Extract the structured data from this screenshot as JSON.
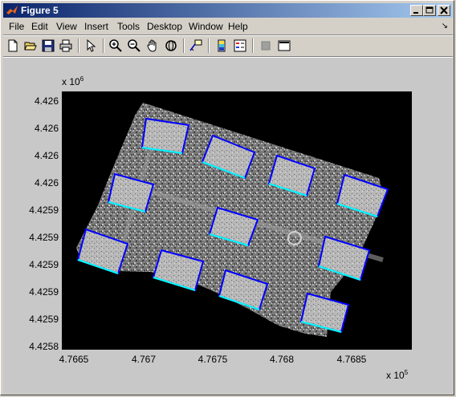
{
  "window": {
    "title": "Figure 5",
    "minimize_icon": "minimize-icon",
    "maximize_icon": "maximize-icon",
    "close_icon": "close-icon"
  },
  "menu": {
    "items": [
      "File",
      "Edit",
      "View",
      "Insert",
      "Tools",
      "Desktop",
      "Window",
      "Help"
    ],
    "dock_arrow": "↘"
  },
  "toolbar": {
    "icons": [
      "new-figure-icon",
      "open-file-icon",
      "save-icon",
      "print-icon",
      "edit-plot-arrow-icon",
      "zoom-in-icon",
      "zoom-out-icon",
      "pan-hand-icon",
      "rotate-3d-icon",
      "data-cursor-icon",
      "colorbar-icon",
      "legend-icon",
      "hide-plot-tools-icon",
      "show-plot-tools-icon"
    ]
  },
  "axes": {
    "y_exponent_base": "x 10",
    "y_exponent_power": "6",
    "x_exponent_base": "x 10",
    "x_exponent_power": "5",
    "ytick_labels": [
      "4.426",
      "4.426",
      "4.426",
      "4.426",
      "4.4259",
      "4.4259",
      "4.4259",
      "4.4259",
      "4.4259",
      "4.4258"
    ],
    "xtick_labels": [
      "4.7665",
      "4.767",
      "4.7675",
      "4.768",
      "4.7685"
    ],
    "background": "#000000",
    "box_outline_colors": [
      "#0000ff",
      "#00ffff"
    ]
  }
}
